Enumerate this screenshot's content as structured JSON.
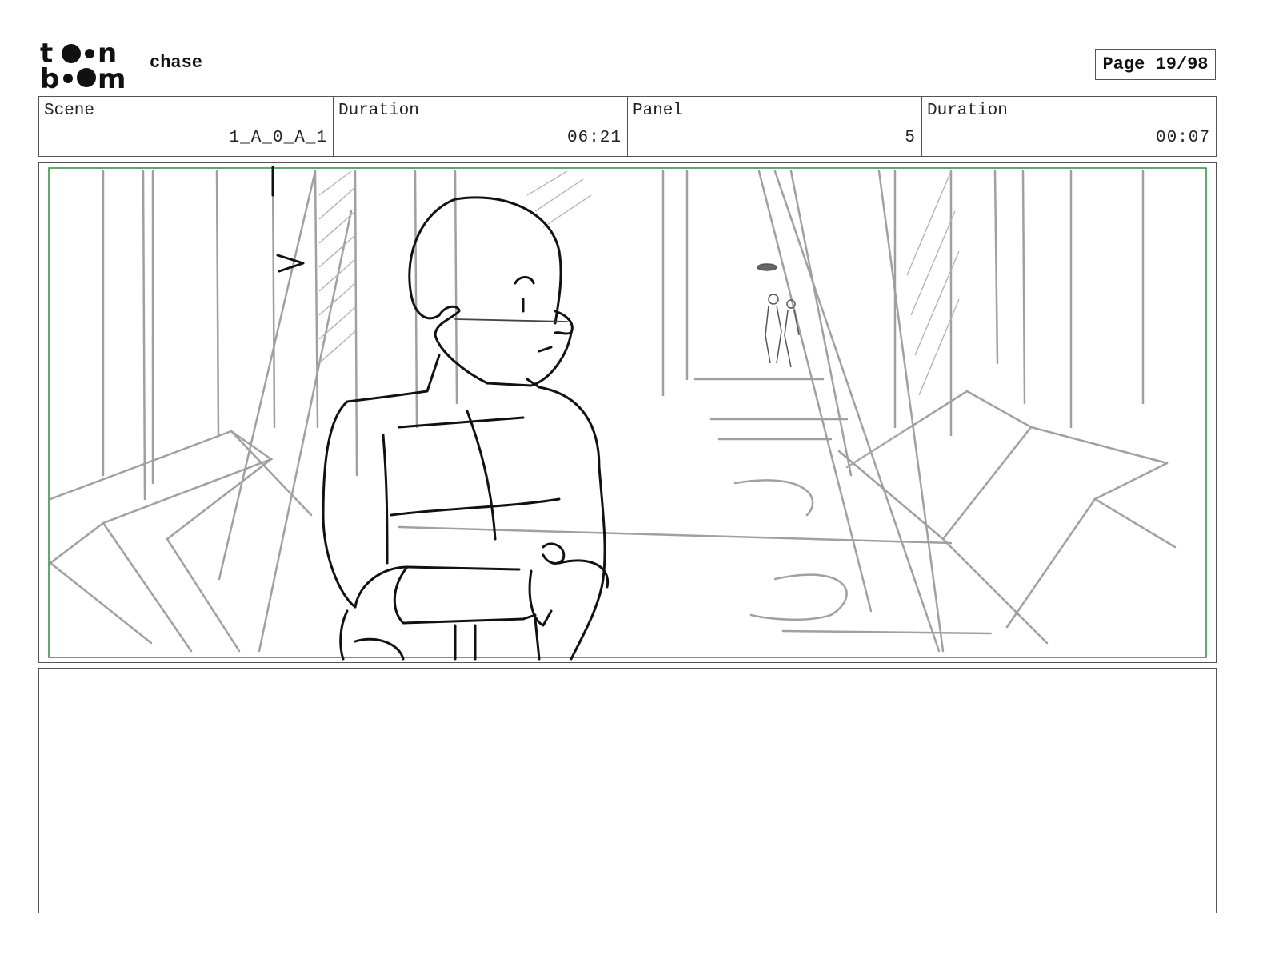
{
  "header": {
    "logo_text": "toon boom",
    "project_title": "chase",
    "page_label": "Page 19/98"
  },
  "info": {
    "scene_label": "Scene",
    "scene_value": "1_A_0_A_1",
    "scene_duration_label": "Duration",
    "scene_duration_value": "06:21",
    "panel_label": "Panel",
    "panel_value": "5",
    "panel_duration_label": "Duration",
    "panel_duration_value": "00:07"
  },
  "notes": {
    "text": ""
  },
  "colors": {
    "safe_frame": "#2e8b3a",
    "sketch_gray": "#9a9a9a",
    "sketch_ink": "#111111"
  }
}
